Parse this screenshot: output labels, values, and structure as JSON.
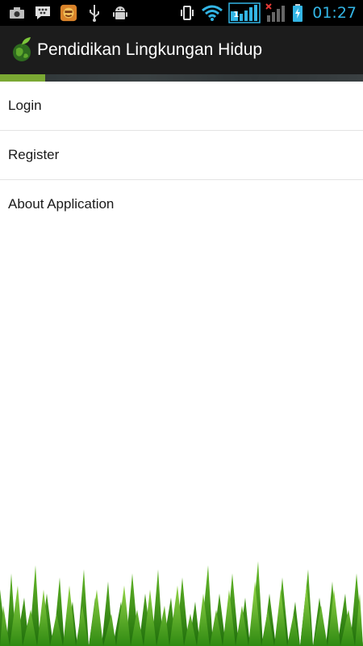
{
  "status_bar": {
    "left_icons": [
      "camera-icon",
      "bbm-chat-icon",
      "game-app-icon",
      "usb-icon",
      "android-debug-icon"
    ],
    "right_icons": [
      "vibrate-icon",
      "wifi-icon",
      "signal-1-icon",
      "signal-2-no-service-icon",
      "battery-charging-icon"
    ],
    "signal_sim_label": "1",
    "time": "01:27",
    "clock_color": "#33b5e5"
  },
  "action_bar": {
    "title": "Pendidikan Lingkungan Hidup",
    "logo_icon": "globe-leaf-logo"
  },
  "menu": {
    "items": [
      {
        "label": "Login"
      },
      {
        "label": "Register"
      },
      {
        "label": "About Application"
      }
    ]
  },
  "colors": {
    "accent_green": "#7aa833",
    "action_bar_bg": "#1c1c1c",
    "grass_green": "#4caf1a"
  }
}
